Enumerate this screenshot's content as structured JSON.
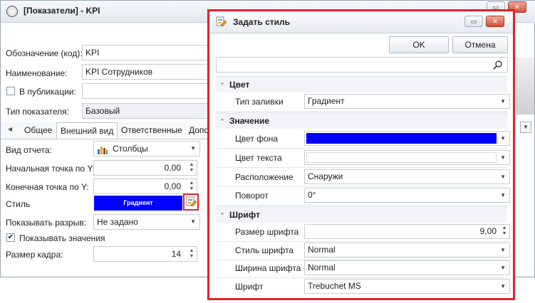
{
  "main": {
    "title": "[Показатели] - KPI",
    "fields": {
      "designation_label": "Обозначение (код):",
      "designation_value": "KPI",
      "name_label": "Наименование:",
      "name_value": "KPI Сотрудников",
      "publish_label": "В публикации:",
      "type_label": "Тип показателя:",
      "type_value": "Базовый"
    },
    "tabs": [
      "Общее",
      "Внешний вид",
      "Ответственные",
      "Допо"
    ],
    "active_tab": "Внешний вид",
    "appearance": {
      "report_type_label": "Вид отчета:",
      "report_type_value": "Столбцы",
      "start_y_label": "Начальная точка по Y:",
      "start_y_value": "0,00",
      "end_y_label": "Конечная точка по Y:",
      "end_y_value": "0,00",
      "style_label": "Стиль",
      "style_value": "Градиент",
      "show_breaks_label": "Показывать разрыв:",
      "show_breaks_value": "Не задано",
      "show_values_label": "Показывать значения",
      "show_values_checked": true,
      "frame_size_label": "Размер кадра:",
      "frame_size_value": "14"
    }
  },
  "dialog": {
    "title": "Задать стиль",
    "ok_label": "OK",
    "cancel_label": "Отмена",
    "search_placeholder": "",
    "sections": {
      "color": {
        "title": "Цвет",
        "fill_type_label": "Тип заливки",
        "fill_type_value": "Градиент"
      },
      "value": {
        "title": "Значение",
        "bg_color_label": "Цвет фона",
        "bg_color_hex": "#0000ff",
        "text_color_label": "Цвет текста",
        "text_color_hex": "#ffffff",
        "position_label": "Расположение",
        "position_value": "Снаружи",
        "rotation_label": "Поворот",
        "rotation_value": "0°"
      },
      "font": {
        "title": "Шрифт",
        "size_label": "Размер шрифта",
        "size_value": "9,00",
        "style_label": "Стиль шрифта",
        "style_value": "Normal",
        "width_label": "Ширина шрифта",
        "width_value": "Normal",
        "family_label": "Шрифт",
        "family_value": "Trebuchet MS"
      }
    }
  },
  "colors": {
    "highlight_border": "#e0222b",
    "gradient_swatch": "#0000ff"
  }
}
